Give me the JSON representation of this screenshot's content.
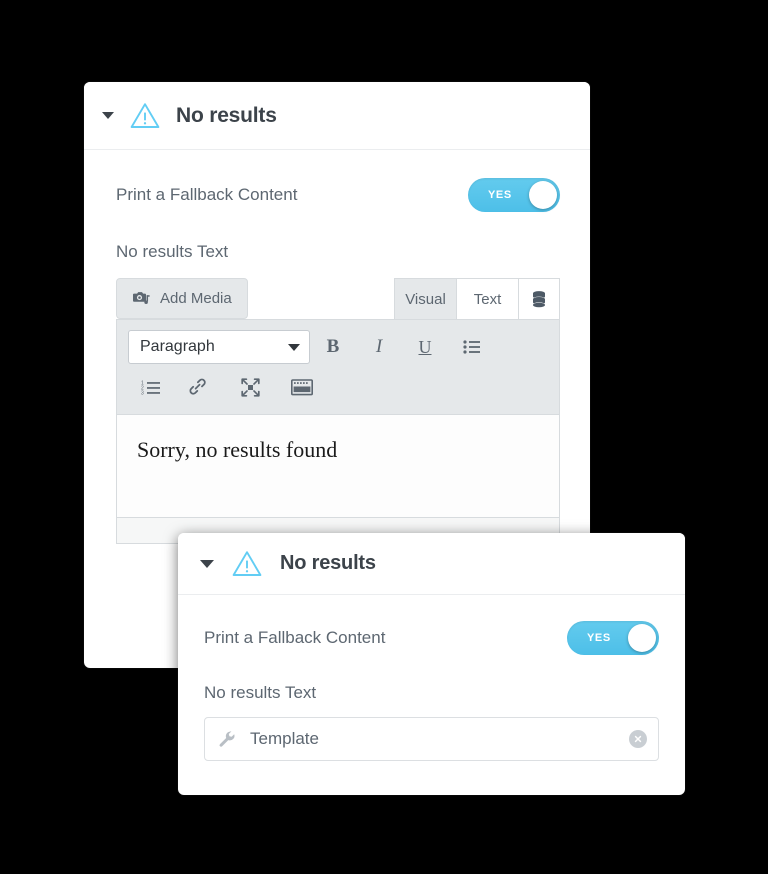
{
  "background_color": "#000000",
  "accent_color": "#4dbfe8",
  "text_color": "#5d6771",
  "title_color": "#3c434a",
  "panels": {
    "back": {
      "title": "No results",
      "warning_icon": "warning-triangle-icon",
      "collapse_icon": "caret-down-icon",
      "fallback": {
        "label": "Print a Fallback Content",
        "toggle_value": "YES",
        "toggle_on": true
      },
      "no_results_text_label": "No results Text",
      "editor": {
        "add_media_label": "Add Media",
        "add_media_icon": "camera-music-icon",
        "tabs": [
          {
            "label": "Visual",
            "active": false
          },
          {
            "label": "Text",
            "active": true
          }
        ],
        "database_icon": "database-stack-icon",
        "toolbar_row1": {
          "format_select": "Paragraph",
          "select_caret_icon": "caret-down-icon",
          "buttons": [
            {
              "icon": "bold-icon",
              "glyph": "B"
            },
            {
              "icon": "italic-icon",
              "glyph": "I"
            },
            {
              "icon": "underline-icon",
              "glyph": "U"
            },
            {
              "icon": "bulleted-list-icon",
              "glyph": ""
            }
          ]
        },
        "toolbar_row2": {
          "buttons": [
            {
              "icon": "numbered-list-icon"
            },
            {
              "icon": "link-icon"
            },
            {
              "icon": "fullscreen-icon"
            },
            {
              "icon": "keyboard-toolbar-toggle-icon"
            }
          ]
        },
        "content": "Sorry, no results found"
      }
    },
    "front": {
      "title": "No results",
      "warning_icon": "warning-triangle-icon",
      "collapse_icon": "caret-down-icon",
      "fallback": {
        "label": "Print a Fallback Content",
        "toggle_value": "YES",
        "toggle_on": true
      },
      "no_results_text_label": "No results Text",
      "template_field": {
        "icon": "wrench-icon",
        "value": "Template",
        "clear_icon": "clear-circle-x-icon"
      }
    }
  }
}
